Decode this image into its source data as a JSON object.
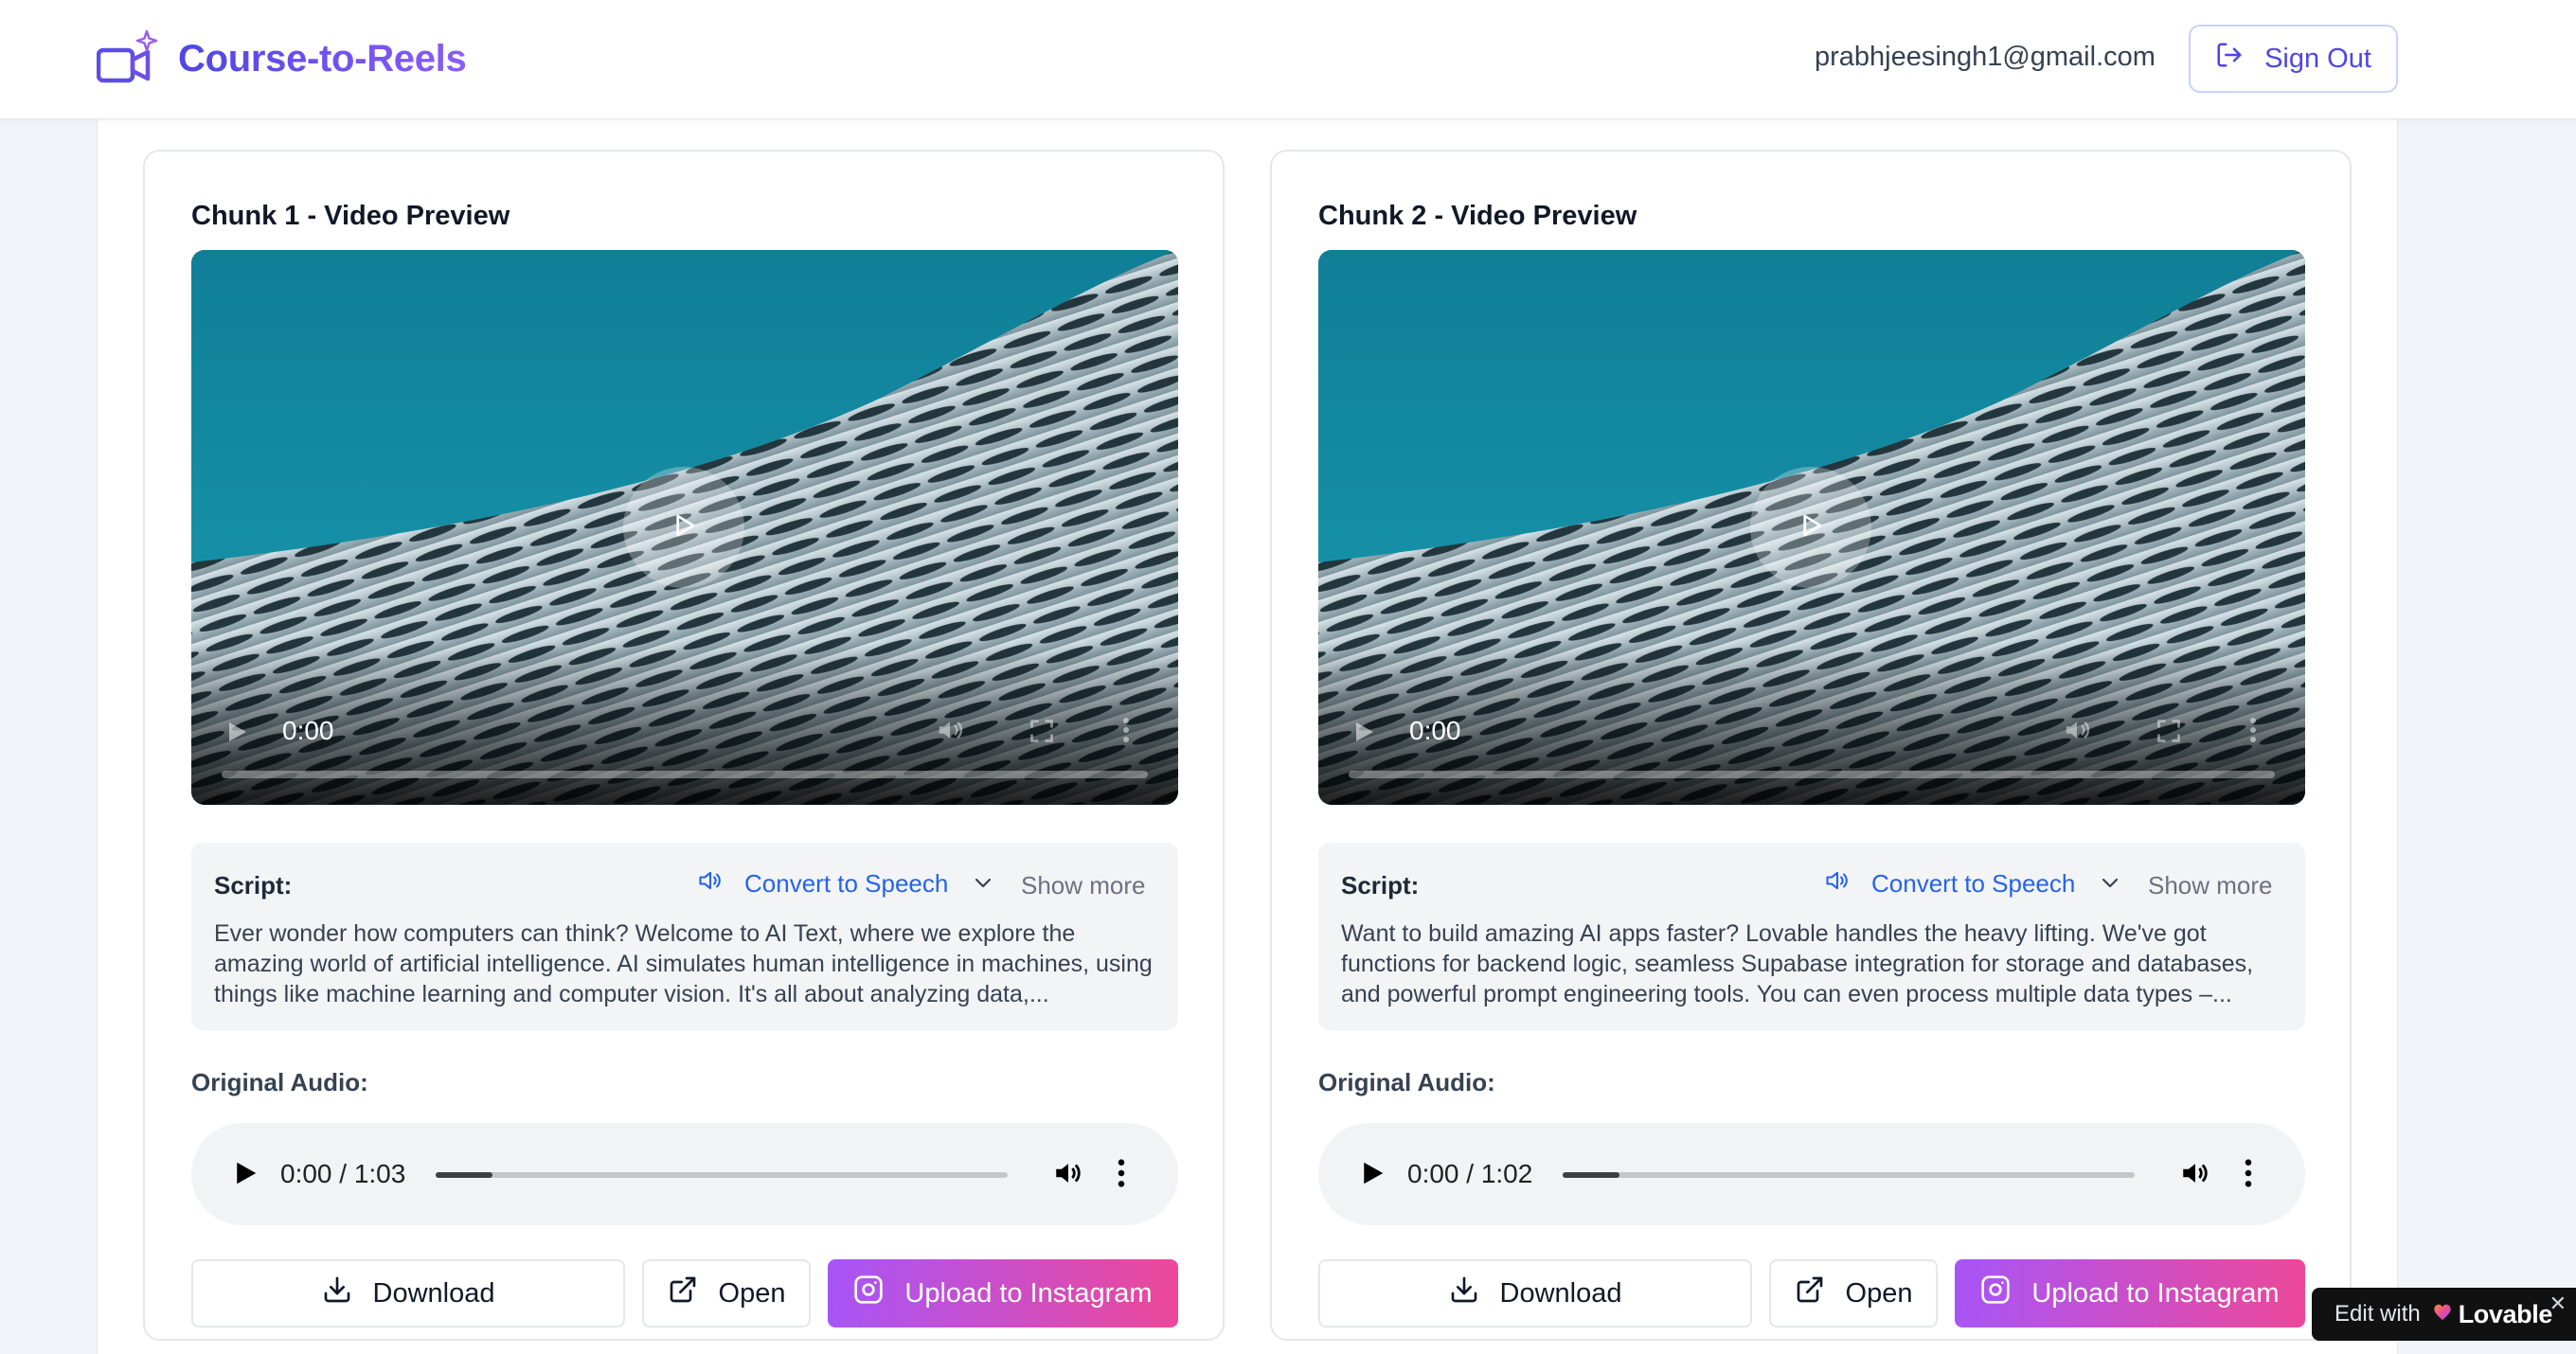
{
  "header": {
    "brand": "Course-to-Reels",
    "email": "prabhjeesingh1@gmail.com",
    "signout_label": "Sign Out"
  },
  "colors": {
    "brand": "#7c3aed",
    "accent_link": "#2563eb",
    "instagram_gradient_start": "#a855f7",
    "instagram_gradient_end": "#ec4899"
  },
  "chunks": [
    {
      "title": "Chunk 1 - Video Preview",
      "video_time": "0:00",
      "script_label": "Script:",
      "tts_label": "Convert to Speech",
      "show_more_label": "Show more",
      "script_text": "Ever wonder how computers can think? Welcome to AI Text, where we explore the amazing world of artificial intelligence. AI simulates human intelligence in machines, using things like machine learning and computer vision. It's all about analyzing data,...",
      "audio_label": "Original Audio:",
      "audio_time": "0:00 / 1:03",
      "audio_progress": 0.1,
      "download_label": "Download",
      "open_label": "Open",
      "instagram_label": "Upload to Instagram"
    },
    {
      "title": "Chunk 2 - Video Preview",
      "video_time": "0:00",
      "script_label": "Script:",
      "tts_label": "Convert to Speech",
      "show_more_label": "Show more",
      "script_text": "Want to build amazing AI apps faster? Lovable handles the heavy lifting. We've got functions for backend logic, seamless Supabase integration for storage and databases, and powerful prompt engineering tools. You can even process multiple data types –...",
      "audio_label": "Original Audio:",
      "audio_time": "0:00 / 1:02",
      "audio_progress": 0.1,
      "download_label": "Download",
      "open_label": "Open",
      "instagram_label": "Upload to Instagram"
    }
  ],
  "badge": {
    "prefix": "Edit with",
    "brand": "Lovable",
    "close": "✕"
  }
}
